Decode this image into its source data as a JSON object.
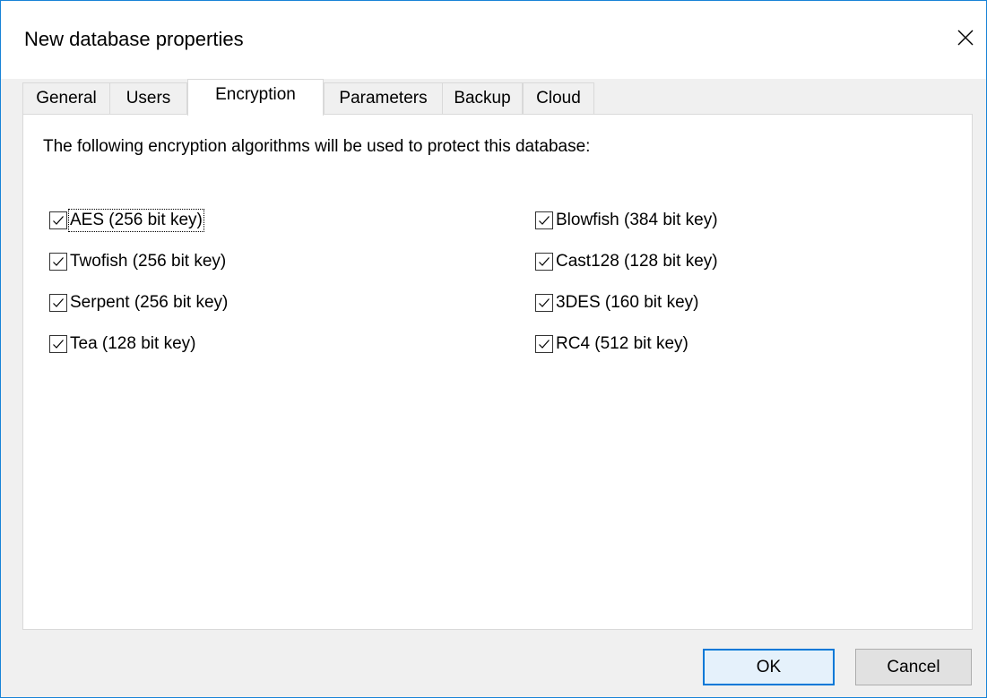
{
  "window": {
    "title": "New database properties"
  },
  "tabs": [
    {
      "label": "General",
      "active": false
    },
    {
      "label": "Users",
      "active": false
    },
    {
      "label": "Encryption",
      "active": true
    },
    {
      "label": "Parameters",
      "active": false
    },
    {
      "label": "Backup",
      "active": false
    },
    {
      "label": "Cloud",
      "active": false
    }
  ],
  "encryption": {
    "description": "The following encryption algorithms will be used to protect this database:",
    "algorithms": [
      {
        "label": "AES (256 bit key)",
        "checked": true,
        "focused": true
      },
      {
        "label": "Twofish (256 bit key)",
        "checked": true
      },
      {
        "label": "Serpent (256 bit key)",
        "checked": true
      },
      {
        "label": "Tea (128 bit key)",
        "checked": true
      },
      {
        "label": "Blowfish (384 bit key)",
        "checked": true
      },
      {
        "label": "Cast128 (128 bit key)",
        "checked": true
      },
      {
        "label": "3DES (160 bit key)",
        "checked": true
      },
      {
        "label": "RC4 (512 bit key)",
        "checked": true
      }
    ]
  },
  "buttons": {
    "ok_label": "OK",
    "cancel_label": "Cancel"
  },
  "icons": {
    "close": "close-icon",
    "check": "checkmark-icon"
  },
  "colors": {
    "window_border": "#1883d7",
    "default_button_border": "#0078d7",
    "default_button_fill": "#e5f1fb"
  }
}
